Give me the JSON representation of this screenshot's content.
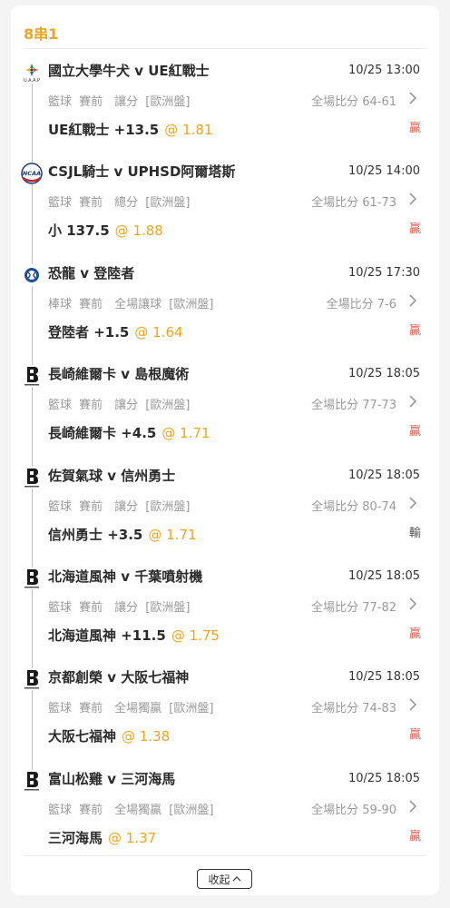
{
  "parlay": {
    "title": "8串1",
    "collapse_label": "收起",
    "legs": [
      {
        "icon": "uaap-logo-icon",
        "match": "國立大學牛犬 v UE紅戰士",
        "time": "10/25 13:00",
        "market": "籃球 賽前　讓分 [歐洲盤]",
        "score": "全場比分 64-61",
        "selection": "UE紅戰士 +13.5",
        "odds": "@ 1.81",
        "result": "贏",
        "won": true
      },
      {
        "icon": "ncaa-logo-icon",
        "match": "CSJL騎士 v UPHSD阿爾塔斯",
        "time": "10/25 14:00",
        "market": "籃球 賽前　總分 [歐洲盤]",
        "score": "全場比分 61-73",
        "selection": "小 137.5",
        "odds": "@ 1.88",
        "result": "贏",
        "won": true
      },
      {
        "icon": "baseball-league-logo-icon",
        "match": "恐龍 v 登陸者",
        "time": "10/25 17:30",
        "market": "棒球 賽前　全場讓球 [歐洲盤]",
        "score": "全場比分 7-6",
        "selection": "登陸者 +1.5",
        "odds": "@ 1.64",
        "result": "贏",
        "won": true
      },
      {
        "icon": "b-league-logo-icon",
        "match": "長崎維爾卡 v 島根魔術",
        "time": "10/25 18:05",
        "market": "籃球 賽前　讓分 [歐洲盤]",
        "score": "全場比分 77-73",
        "selection": "長崎維爾卡 +4.5",
        "odds": "@ 1.71",
        "result": "贏",
        "won": true
      },
      {
        "icon": "b-league-logo-icon",
        "match": "佐賀氣球 v 信州勇士",
        "time": "10/25 18:05",
        "market": "籃球 賽前　讓分 [歐洲盤]",
        "score": "全場比分 80-74",
        "selection": "信州勇士 +3.5",
        "odds": "@ 1.71",
        "result": "輸",
        "won": false
      },
      {
        "icon": "b-league-logo-icon",
        "match": "北海道風神 v 千葉噴射機",
        "time": "10/25 18:05",
        "market": "籃球 賽前　讓分 [歐洲盤]",
        "score": "全場比分 77-82",
        "selection": "北海道風神 +11.5",
        "odds": "@ 1.75",
        "result": "贏",
        "won": true
      },
      {
        "icon": "b-league-logo-icon",
        "match": "京都創榮 v 大阪七福神",
        "time": "10/25 18:05",
        "market": "籃球 賽前　全場獨贏 [歐洲盤]",
        "score": "全場比分 74-83",
        "selection": "大阪七福神",
        "odds": "@ 1.38",
        "result": "贏",
        "won": true
      },
      {
        "icon": "b-league-logo-icon",
        "match": "富山松雞 v 三河海馬",
        "time": "10/25 18:05",
        "market": "籃球 賽前　全場獨贏 [歐洲盤]",
        "score": "全場比分 59-90",
        "selection": "三河海馬",
        "odds": "@ 1.37",
        "result": "贏",
        "won": true
      }
    ]
  },
  "colors": {
    "accent": "#f3a41b",
    "win": "#e45b4c",
    "lose": "#555555",
    "timeline": "#f3c13c"
  }
}
